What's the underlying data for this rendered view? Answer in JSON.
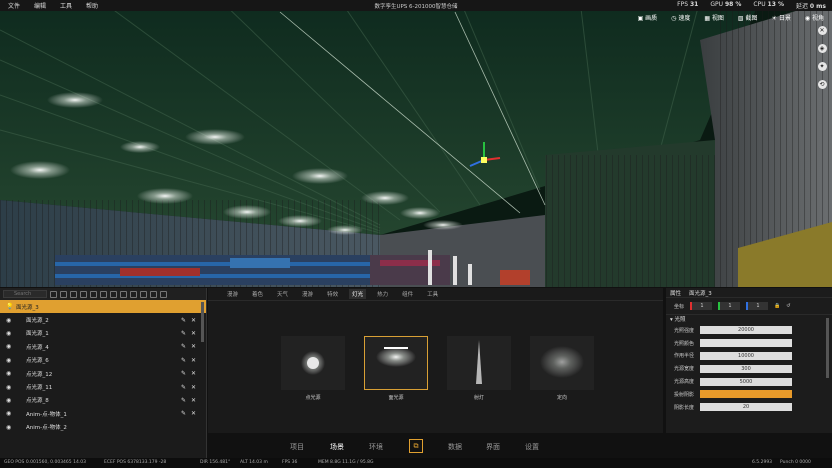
{
  "topbar": {
    "menu": [
      "文件",
      "编辑",
      "工具",
      "帮助"
    ],
    "title": "数字孪生UPS 6-201000智慧仓储",
    "fps_label": "FPS",
    "fps_value": "31",
    "gpu_label": "GPU",
    "gpu_value": "98 %",
    "cpu_label": "CPU",
    "cpu_value": "13 %",
    "delay_label": "延迟",
    "delay_value": "0 ms"
  },
  "view_buttons": [
    "画质",
    "速度",
    "视图",
    "截图",
    "日景",
    "视角"
  ],
  "left_panel": {
    "search_placeholder": "Search",
    "layers": [
      {
        "name": "面光源_3",
        "selected": true
      },
      {
        "name": "面光源_2",
        "selected": false
      },
      {
        "name": "面光源_1",
        "selected": false
      },
      {
        "name": "点光源_4",
        "selected": false
      },
      {
        "name": "点光源_6",
        "selected": false
      },
      {
        "name": "点光源_12",
        "selected": false
      },
      {
        "name": "点光源_11",
        "selected": false
      },
      {
        "name": "点光源_8",
        "selected": false
      },
      {
        "name": "Anim-点-物体_1",
        "selected": false
      },
      {
        "name": "Anim-点-物体_2",
        "selected": false
      }
    ]
  },
  "mid_panel": {
    "tabs": [
      "漫游",
      "着色",
      "天气",
      "漫游",
      "特效",
      "灯光",
      "热力",
      "组件",
      "工具"
    ],
    "active_tab": 5,
    "cards": [
      {
        "label": "点光源"
      },
      {
        "label": "面光源"
      },
      {
        "label": "射灯"
      },
      {
        "label": "定向"
      }
    ],
    "selected_card": 1
  },
  "right_panel": {
    "tab": "属性",
    "object": "面光源_3",
    "field_label": "坐标",
    "pos": [
      "1",
      "1",
      "1"
    ],
    "section": "光照",
    "props": [
      {
        "label": "光照强度",
        "value": "20000"
      },
      {
        "label": "光照颜色",
        "value": ""
      },
      {
        "label": "作用半径",
        "value": "10000"
      },
      {
        "label": "光源宽度",
        "value": "300"
      },
      {
        "label": "光源高度",
        "value": "5000"
      },
      {
        "label": "投射阴影",
        "value": ""
      },
      {
        "label": "阴影长度",
        "value": "20"
      }
    ]
  },
  "bottom_nav": [
    "项目",
    "场景",
    "环境",
    "",
    "数据",
    "界面",
    "设置"
  ],
  "bottom_active": 1,
  "statusbar": {
    "geo": "GEO POS 0.001560, 0.003465 14.03",
    "ecef": "ECEF POS 6378133.179 -28",
    "dir": "DIR 156.481°",
    "alt": "ALT 14.03 m",
    "fps": "FPS 36",
    "mem": "MEM 8.8G 11.1G / 95.8G",
    "time": "6.5.2993",
    "punch": "Punch 0 0000"
  },
  "colors": {
    "accent": "#e0a030",
    "panel": "#1b1b1b",
    "highlight": "#d9a035"
  }
}
